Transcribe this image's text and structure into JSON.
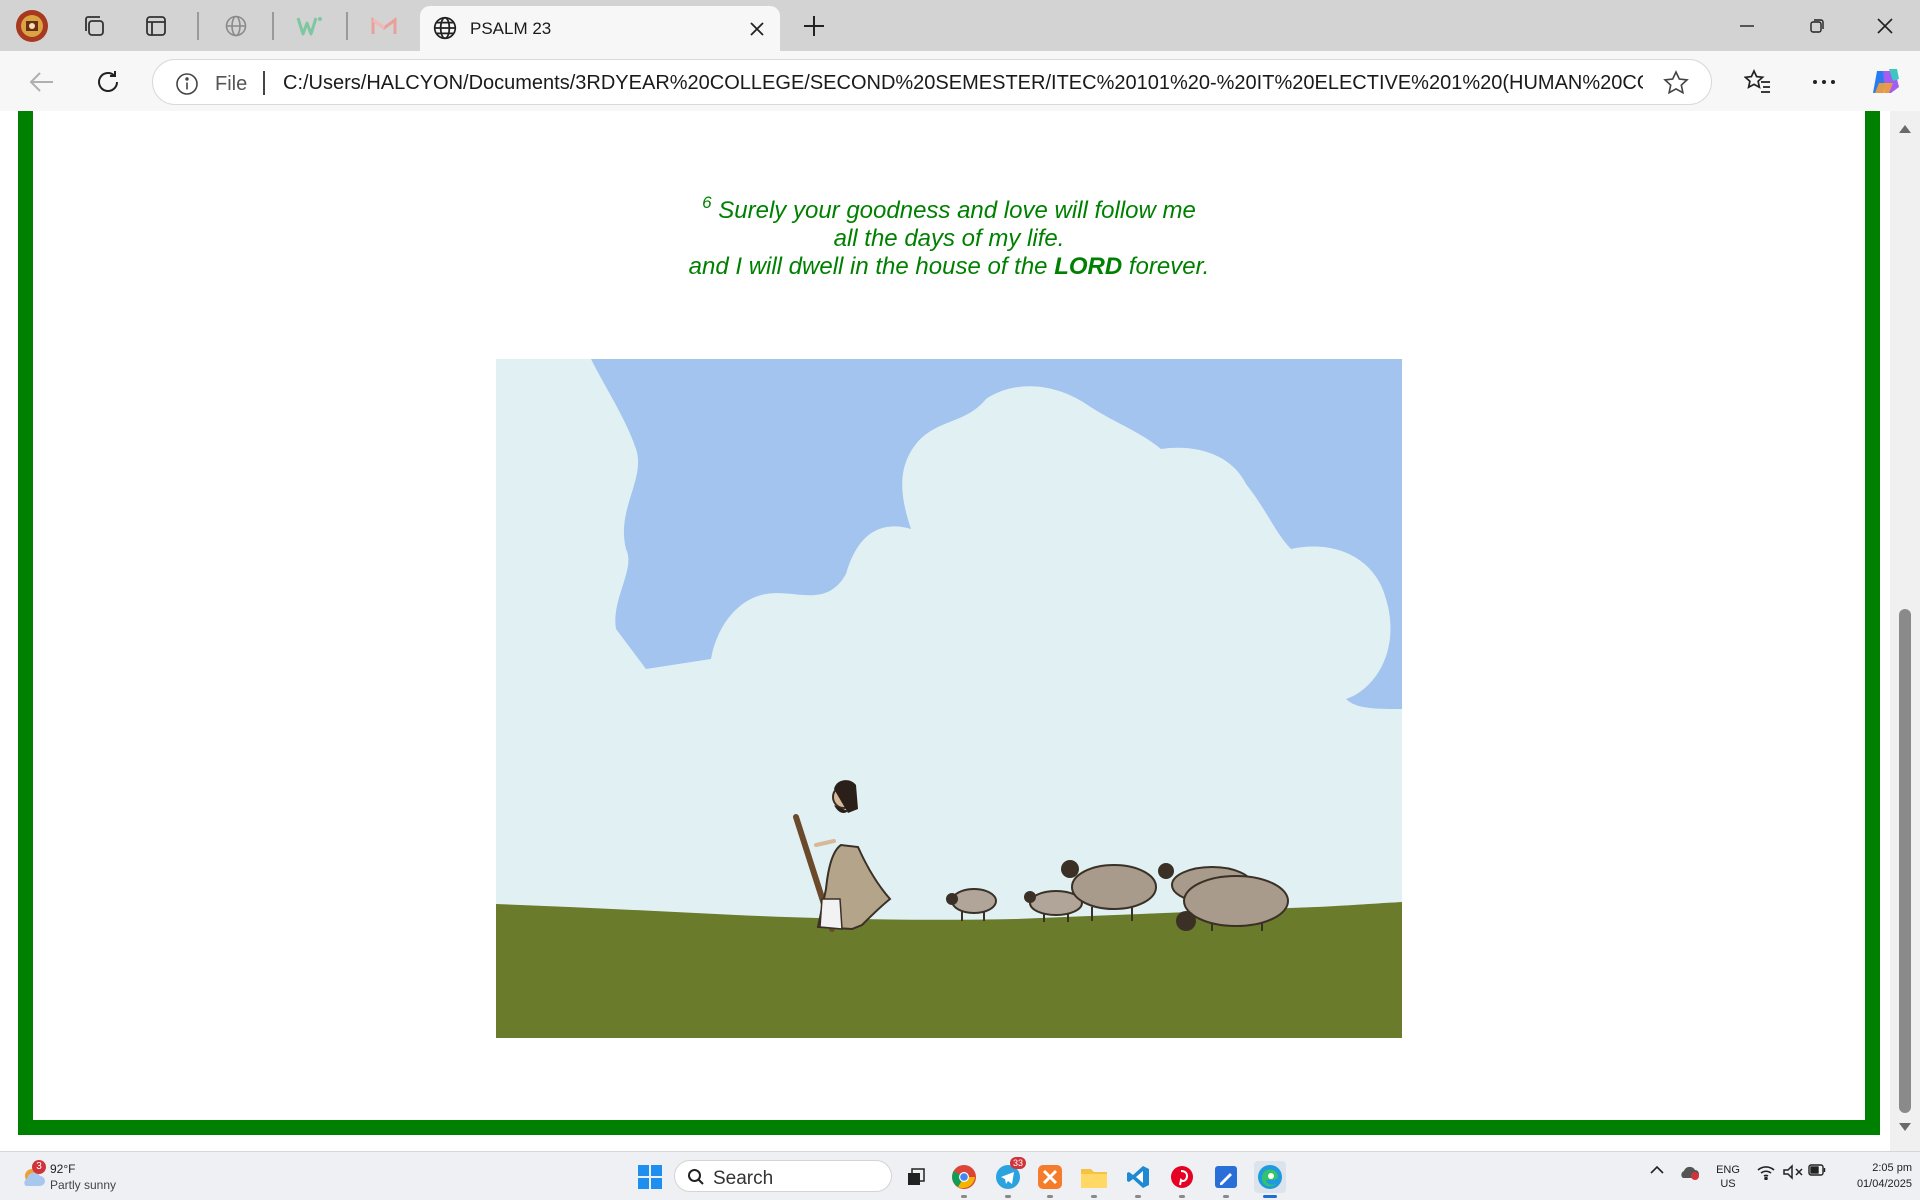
{
  "browser": {
    "tabs": [
      {
        "title": "PSALM 23",
        "active": true
      }
    ],
    "address": {
      "scheme_label": "File",
      "url": "C:/Users/HALCYON/Documents/3RDYEAR%20COLLEGE/SECOND%20SEMESTER/ITEC%20101%20-%20IT%20ELECTIVE%201%20(HUMAN%20CO..."
    },
    "toolbar_icons": [
      "profile-avatar-icon",
      "workspaces-icon",
      "tab-actions-icon",
      "globe-icon",
      "wps-icon",
      "gmail-icon"
    ]
  },
  "page": {
    "verse": {
      "number": "6",
      "line1": "Surely your goodness and love will follow me",
      "line2": "all the days of my life.",
      "line3_before": "and I will dwell in the house of the ",
      "line3_bold": "LORD",
      "line3_after": " forever."
    },
    "image": "shepherd-with-sheep-illustration",
    "colors": {
      "frame": "#008000",
      "verse_text": "#008000",
      "sky": "#a3c4ef",
      "cloud": "#e1f1f3",
      "grass": "#6b7b2c"
    }
  },
  "taskbar": {
    "weather": {
      "temp": "92°F",
      "condition": "Partly sunny",
      "badge": "3"
    },
    "search_label": "Search",
    "apps": [
      "task-view-icon",
      "chrome-icon",
      "telegram-icon",
      "xampp-icon",
      "file-explorer-icon",
      "vscode-icon",
      "pinterest-icon",
      "draw-icon",
      "edge-icon"
    ],
    "telegram_badge": "33",
    "language": {
      "line1": "ENG",
      "line2": "US"
    },
    "time": "2:05 pm",
    "date": "01/04/2025"
  }
}
